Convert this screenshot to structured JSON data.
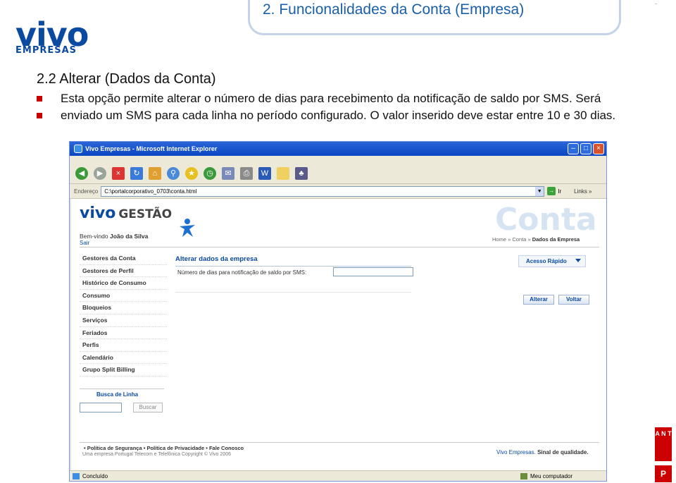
{
  "slide": {
    "title": "2. Funcionalidades da Conta (Empresa)",
    "corner_mark": "-",
    "logo_top": "vivo",
    "logo_bottom": "EMPRESAS",
    "section_heading": "2.2 Alterar (Dados da Conta)",
    "body_text": "Esta opção permite alterar o número de dias para recebimento da notificação de saldo por SMS. Será enviado um SMS para cada linha no período configurado. O valor inserido deve estar entre 10 e 30 dias.",
    "badge_letters": "A N T",
    "badge_bottom": "P"
  },
  "browser": {
    "window_title": "Vivo Empresas - Microsoft Internet Explorer",
    "address_label": "Endereço",
    "address_url": "C:\\portalcorporativo_0703\\conta.html",
    "go_label": "Ir",
    "links_label": "Links »",
    "status_left": "Concluído",
    "status_right": "Meu computador"
  },
  "page": {
    "logo_vivo": "vivo",
    "logo_gestao": "GESTÃO",
    "conta_watermark": "Conta",
    "welcome_prefix": "Bem-vindo ",
    "user_name": "João da Silva",
    "logout": "Sair",
    "breadcrumb_prefix": "Home » Conta » ",
    "breadcrumb_current": "Dados da Empresa",
    "menu": [
      "Gestores da Conta",
      "Gestores de Perfil",
      "Histórico de Consumo",
      "Consumo",
      "Bloqueios",
      "Serviços",
      "Feriados",
      "Perfis",
      "Calendário",
      "Grupo Split Billing"
    ],
    "form_heading": "Alterar dados da empresa",
    "field_label": "Número de dias para notificação de saldo por SMS:",
    "field_value": "",
    "quick_access": "Acesso Rápido",
    "alter_button": "Alterar",
    "back_button": "Voltar",
    "search_title": "Busca de Linha",
    "search_button": "Buscar",
    "footer_links": "• Política de Segurança  • Política de Privacidade  • Fale Conosco",
    "footer_sub": "Uma empresa Portugal Telecom e Telefônica    Copyright © Vivo 2006",
    "footer_brand": "Vivo Empresas.",
    "footer_tagline": " Sinal de qualidade."
  },
  "colors": {
    "brand_blue": "#0a4aa0",
    "bullet_red": "#cc0000",
    "slide_title_blue": "#1a5fa8",
    "xp_titlebar": "#0b46c2"
  },
  "icons": [
    "back-icon",
    "forward-icon",
    "stop-icon",
    "refresh-icon",
    "home-icon",
    "search-icon",
    "favorites-icon",
    "history-icon",
    "mail-icon",
    "print-icon",
    "edit-icon",
    "folder-icon",
    "messenger-icon"
  ]
}
